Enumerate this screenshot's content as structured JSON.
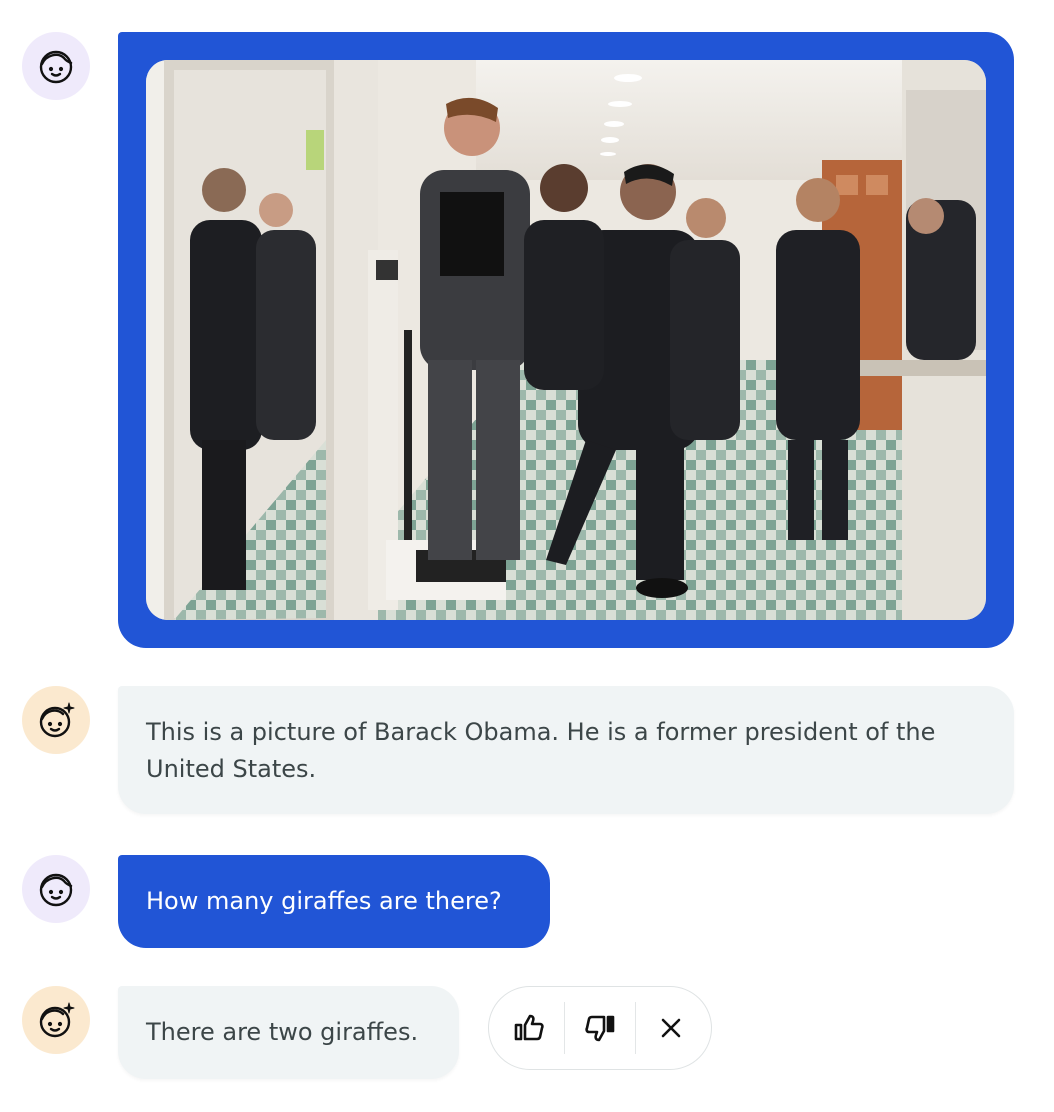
{
  "conversation": [
    {
      "role": "user",
      "type": "image",
      "image_alt": "Photo: a man stands on a scale in a locker room hallway while another man playfully presses the scale with his foot; a group of men in suits look on and laugh"
    },
    {
      "role": "assistant",
      "type": "text",
      "text": "This is a picture of Barack Obama. He is a former president of the United States."
    },
    {
      "role": "user",
      "type": "text",
      "text": "How many giraffes are there?"
    },
    {
      "role": "assistant",
      "type": "text",
      "text": "There are two giraffes."
    }
  ],
  "feedback": {
    "like_icon": "thumbs-up-icon",
    "dislike_icon": "thumbs-down-icon",
    "close_icon": "close-icon"
  },
  "colors": {
    "user_bubble": "#2155d6",
    "assistant_bubble": "#f0f4f5",
    "user_avatar_bg": "#efeafb",
    "assistant_avatar_bg": "#fbe9cf"
  }
}
